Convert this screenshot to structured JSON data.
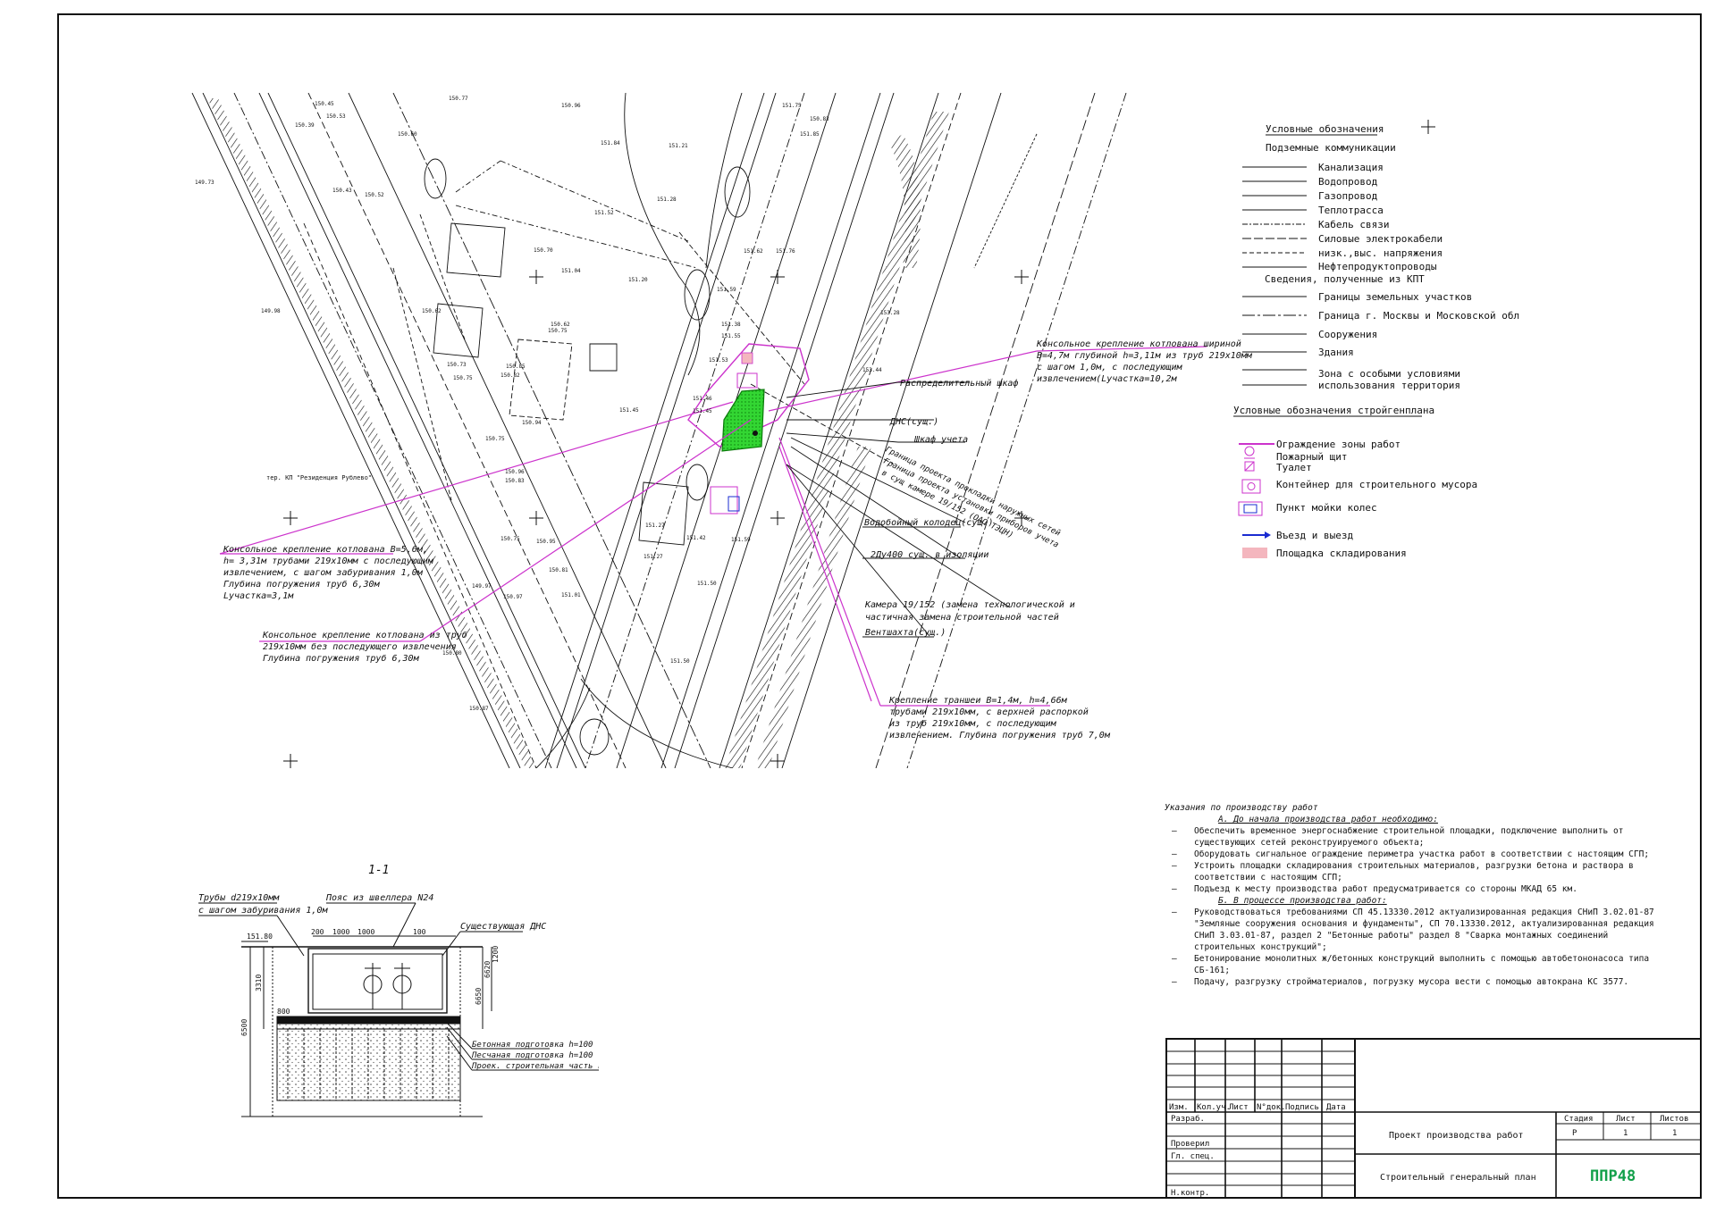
{
  "legend": {
    "title": "Условные обозначения",
    "underground": "Подземные коммуникации",
    "items": [
      "Канализация",
      "Водопровод",
      "Газопровод",
      "Теплотрасса",
      "Кабель связи",
      "Силовые электрокабели",
      "низк.,выс. напряжения",
      "Нефтепродуктопроводы"
    ],
    "kpt_title": "Сведения, полученные из КПТ",
    "kpt_items": [
      "Границы земельных участков",
      "Граница г. Москвы и Московской обл.",
      "Сооружения",
      "Здания",
      "Зона с особыми условиями",
      "использования территория"
    ],
    "sgp_title": "Условные обозначения стройгенплана",
    "sgp_items": [
      "Ограждение зоны работ",
      "Пожарный щит",
      "Туалет",
      "Контейнер для строительного мусора",
      "Пункт мойки колес",
      "Въезд   и выезд",
      "Площадка складирования"
    ],
    "colors": {
      "fence": "#cc33cc",
      "storage": "#f4b6be",
      "arrow": "#1a2bd1",
      "green": "#22cc22"
    }
  },
  "plan": {
    "annotations": {
      "a1": [
        "Консольное крепление котлована   шириной",
        "В=4,7м глубиной h=3,11м из труб 219х10мм",
        "с шагом 1,0м, с последующим",
        "извлечением(Lучастка=10,2м"
      ],
      "a2": "Распределительный шкаф",
      "a3": "ДНС(сущ.)",
      "a4": "Шкаф учета",
      "a5": [
        "Граница проекта прокладки наружных сетей",
        "Граница проекта установки приборов учета",
        "в сущ камере 19/152 (ОАО ТЭЦН)"
      ],
      "a6": "Водобойный колодец(сущ.)",
      "a7": "2Ду400 сущ. в изоляции",
      "a8": [
        "Камера 19/152 (замена технологической и",
        "частичная замена строительной частей"
      ],
      "a9": "Вентшахта(сущ.)",
      "a10": [
        "Крепление траншеи   В=1,4м, h=4,66м",
        "трубами 219х10мм, с верхней  распоркой",
        "из труб 219х10мм, с последующим",
        "извлечением. Глубина погружения труб 7,0м"
      ],
      "a11": [
        "Консольное крепление котлована  В=5,6м,",
        "h= 3,31м трубами 219х10мм с последующим",
        "извлечением, с шагом забуривания  1,0м",
        "Глубина погружения труб 6,30м",
        "Lучастка=3,1м"
      ],
      "a12": [
        "Консольное крепление котлована из труб",
        "219х10мм без последующего извлечения",
        "Глубина погружения труб 6,30м"
      ],
      "kp": "тер. КП \"Резиденция Рублево\""
    },
    "elevations": [
      "150.77",
      "150.96",
      "151.84",
      "151.21",
      "151.85",
      "151.75",
      "150.83",
      "151.28",
      "151.62",
      "151.76",
      "150.45",
      "150.53",
      "150.39",
      "150.60",
      "149.73",
      "149.98",
      "150.43",
      "150.52",
      "151.20",
      "151.04",
      "150.62",
      "150.73",
      "150.75",
      "150.82",
      "150.75",
      "150.75",
      "150.62",
      "150.94",
      "150.85",
      "150.83",
      "150.95",
      "151.59",
      "151.53",
      "151.46",
      "151.45",
      "151.45",
      "151.27",
      "151.42",
      "151.50",
      "151.50",
      "151.59",
      "151.38",
      "151.55",
      "150.81",
      "150.97",
      "150.80",
      "151.01",
      "151.27",
      "151.52",
      "150.70",
      "150.75",
      "150.96",
      "150.87",
      "149.97",
      "153.28",
      "153.44"
    ]
  },
  "section": {
    "title": "1-1",
    "labels": [
      "Трубы d219х10мм",
      "с шагом забуривания 1,0м",
      "Пояс из швеллера N24",
      "Существующая ДНС",
      "Бетонная подготовка h=100",
      "Песчаная подготовка h=100",
      "Проек. строительная часть камеры"
    ],
    "dims": [
      "151.80",
      "200",
      "1000",
      "1000",
      "100",
      "3310",
      "6500",
      "6650",
      "6620",
      "1200",
      "800"
    ]
  },
  "notes": {
    "title": "Указания по производству работ",
    "sub_a": "А. До начала производства работ необходимо:",
    "list_a": [
      "Обеспечить временное энергоснабжение строительной площадки, подключение выполнить от существующих сетей реконструируемого объекта;",
      "Оборудовать сигнальное ограждение периметра участка работ в соответствии с настоящим СГП;",
      "Устроить площадки складирования строительных материалов, разгрузки бетона и раствора в соответствии с настоящим СГП;",
      "Подъезд к месту производства работ предусматривается со стороны МКАД 65 км."
    ],
    "sub_b": "Б. В процессе производства работ:",
    "list_b": [
      "Руководствоваться требованиями СП 45.13330.2012 актуализированная редакция СНиП 3.02.01-87 \"Земляные сооружения основания и фундаменты\", СП 70.13330.2012, актуализированная редакция СНиП 3.03.01-87, раздел 2 \"Бетонные работы\" раздел 8 \"Сварка монтажных соединений строительных конструкций\";",
      "Бетонирование монолитных ж/бетонных конструкций выполнить с помощью автобетононасоса типа СБ-161;",
      "Подачу, разгрузку стройматериалов, погрузку мусора вести с помощью автокрана КС 3577."
    ]
  },
  "title_block": {
    "cols": [
      "Изм.",
      "Кол.уч.",
      "Лист",
      "N°док.",
      "Подпись",
      "Дата"
    ],
    "rows": [
      "Разраб.",
      "",
      "Проверил",
      "Гл. спец.",
      "Н.контр."
    ],
    "project": "Проект производства работ",
    "sheet_name": "Строительный генеральный план",
    "stage_h": "Стадия",
    "sheet_h": "Лист",
    "sheets_h": "Листов",
    "stage": "Р",
    "sheet": "1",
    "sheets": "1",
    "logo": "ППР48",
    "logo_color": "#12a04a"
  }
}
